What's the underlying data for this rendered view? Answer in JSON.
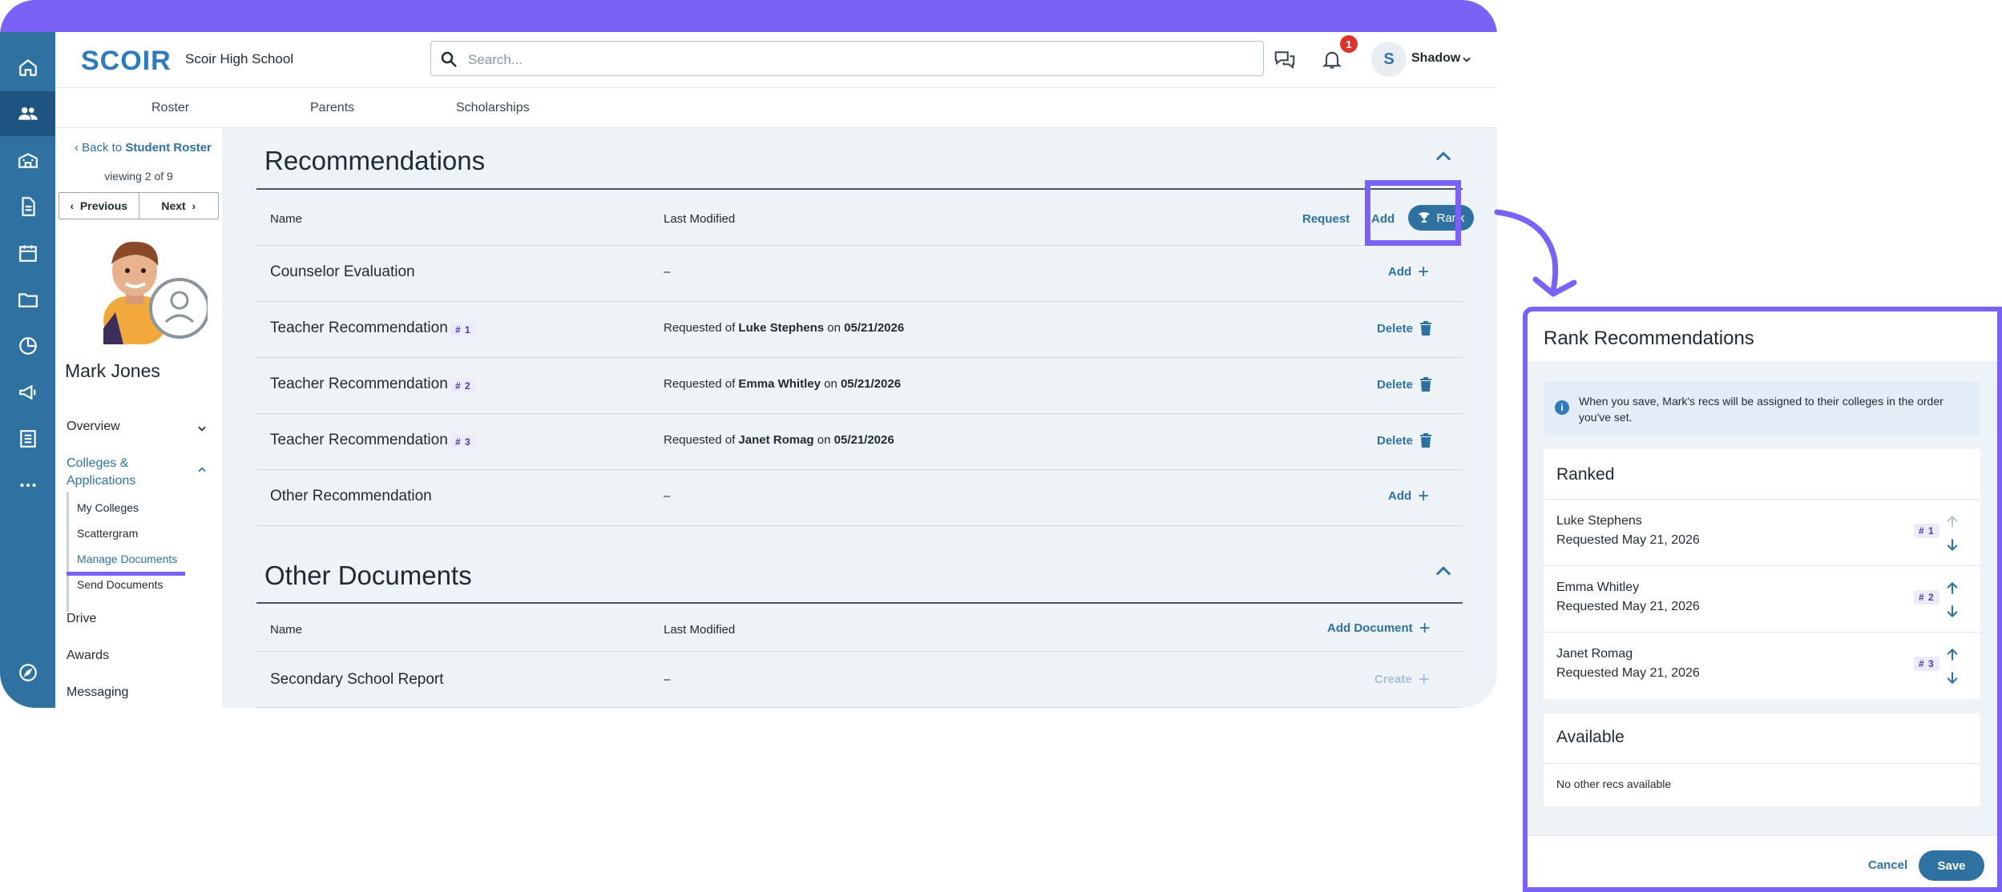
{
  "header": {
    "logo": "SCOIR",
    "school": "Scoir High School",
    "search_placeholder": "Search...",
    "notification_count": "1",
    "user_initial": "S",
    "user_name": "Shadow"
  },
  "rail": [
    "home-icon",
    "people-icon",
    "school-icon",
    "document-icon",
    "calendar-icon",
    "folder-icon",
    "pie-chart-icon",
    "megaphone-icon",
    "list-icon",
    "more-icon",
    "compass-icon"
  ],
  "subnav": [
    "Roster",
    "Parents",
    "Scholarships"
  ],
  "sidebar": {
    "back_prefix": "Back to ",
    "back_link": "Student Roster",
    "viewing": "viewing 2 of 9",
    "previous": "Previous",
    "next": "Next",
    "student_name": "Mark Jones",
    "overview": "Overview",
    "colleges_apps": "Colleges &",
    "colleges_apps2": "Applications",
    "subitems": [
      "My Colleges",
      "Scattergram",
      "Manage Documents",
      "Send Documents"
    ],
    "drive": "Drive",
    "awards": "Awards",
    "messaging": "Messaging"
  },
  "recommendations": {
    "title": "Recommendations",
    "col_name": "Name",
    "col_modified": "Last Modified",
    "request": "Request",
    "add": "Add",
    "rank": "Rank",
    "rows": [
      {
        "name": "Counselor Evaluation",
        "tag": "",
        "modified": "–",
        "action": "Add"
      },
      {
        "name": "Teacher Recommendation",
        "tag": "# 1",
        "req_prefix": "Requested of ",
        "person": "Luke Stephens",
        "on": " on ",
        "date": "05/21/2026",
        "action": "Delete"
      },
      {
        "name": "Teacher Recommendation",
        "tag": "# 2",
        "req_prefix": "Requested of ",
        "person": "Emma Whitley",
        "on": " on ",
        "date": "05/21/2026",
        "action": "Delete"
      },
      {
        "name": "Teacher Recommendation",
        "tag": "# 3",
        "req_prefix": "Requested of ",
        "person": "Janet Romag",
        "on": " on ",
        "date": "05/21/2026",
        "action": "Delete"
      },
      {
        "name": "Other Recommendation",
        "tag": "",
        "modified": "–",
        "action": "Add"
      }
    ]
  },
  "other_documents": {
    "title": "Other Documents",
    "col_name": "Name",
    "col_modified": "Last Modified",
    "add_document": "Add Document",
    "rows": [
      {
        "name": "Secondary School Report",
        "modified": "–",
        "action": "Create"
      }
    ]
  },
  "modal": {
    "title": "Rank Recommendations",
    "info": "When you save, Mark's recs will be assigned to their colleges in the order you've set.",
    "ranked_title": "Ranked",
    "ranked": [
      {
        "name": "Luke Stephens",
        "requested": "Requested May 21, 2026",
        "tag": "# 1"
      },
      {
        "name": "Emma Whitley",
        "requested": "Requested May 21, 2026",
        "tag": "# 2"
      },
      {
        "name": "Janet Romag",
        "requested": "Requested May 21, 2026",
        "tag": "# 3"
      }
    ],
    "available_title": "Available",
    "available_empty": "No other recs available",
    "cancel": "Cancel",
    "save": "Save"
  },
  "colors": {
    "accent": "#7b61f5",
    "primary": "#2f72a1",
    "rail": "#2f72a1",
    "badge": "#d8372e"
  }
}
